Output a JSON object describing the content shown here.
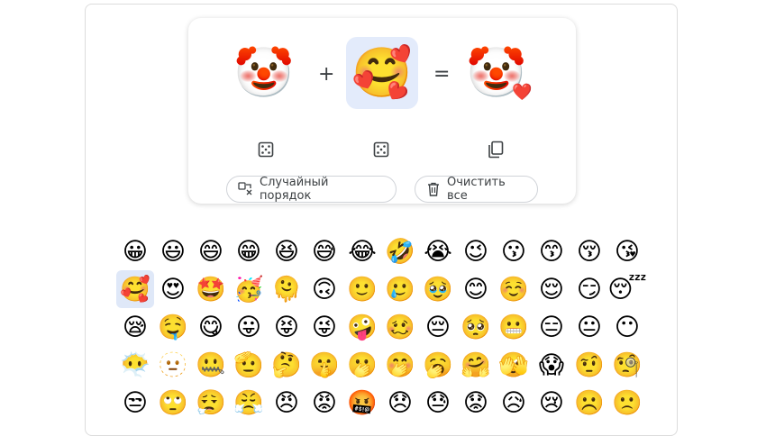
{
  "mixer": {
    "left_emoji": "🤡",
    "right_emoji": "🥰",
    "result_emoji": "🤡",
    "result_overlay": "❤️",
    "plus": "+",
    "equals": "=",
    "shuffle_label": "Случайный порядок",
    "clear_label": "Очистить все",
    "icons": {
      "left_random": "dice-icon",
      "right_random": "dice-icon",
      "copy": "copy-icon",
      "shuffle": "shuffle-icon",
      "clear": "trash-icon"
    }
  },
  "accent_selected_bg": "#e3ebfb",
  "emoji_grid": [
    [
      "😀",
      "😃",
      "😄",
      "😁",
      "😆",
      "😅",
      "😂",
      "🤣",
      "😭",
      "😉",
      "😗",
      "😙",
      "😚",
      "😘"
    ],
    [
      "🥰",
      "😍",
      "🤩",
      "🥳",
      "🫠",
      "🙃",
      "🙂",
      "🥲",
      "🥹",
      "😊",
      "☺️",
      "😌",
      "😏",
      "😴"
    ],
    [
      "😪",
      "🤤",
      "😋",
      "😛",
      "😝",
      "😜",
      "🤪",
      "🥴",
      "😔",
      "🥺",
      "😬",
      "😑",
      "😐",
      "😶"
    ],
    [
      "😶‍🌫️",
      "🫥",
      "🤐",
      "🫡",
      "🤔",
      "🤫",
      "🫢",
      "🤭",
      "🥱",
      "🤗",
      "🫣",
      "😱",
      "🤨",
      "🧐"
    ],
    [
      "😒",
      "🙄",
      "😮‍💨",
      "😤",
      "😠",
      "😡",
      "🤬",
      "😞",
      "😓",
      "😟",
      "😥",
      "😢",
      "☹️",
      "🙁"
    ]
  ],
  "selected_grid_index": [
    1,
    0
  ]
}
